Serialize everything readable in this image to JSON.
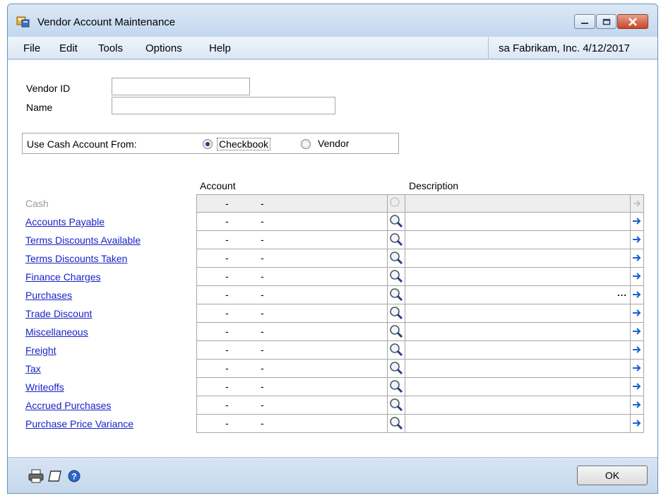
{
  "window": {
    "title": "Vendor Account Maintenance"
  },
  "menu": {
    "items": [
      "File",
      "Edit",
      "Tools",
      "Options",
      "Help"
    ],
    "status": "sa  Fabrikam, Inc. 4/12/2017"
  },
  "form": {
    "vendor_id_label": "Vendor ID",
    "vendor_id_value": "",
    "name_label": "Name",
    "name_value": "",
    "cash_from_label": "Use Cash Account From:",
    "option_checkbook": "Checkbook",
    "option_vendor": "Vendor",
    "selected_option": "Checkbook"
  },
  "grid": {
    "col_account": "Account",
    "col_description": "Description",
    "rows": [
      {
        "label": "Cash",
        "enabled": false
      },
      {
        "label": "Accounts Payable",
        "enabled": true
      },
      {
        "label": "Terms Discounts Available",
        "enabled": true
      },
      {
        "label": "Terms Discounts Taken",
        "enabled": true
      },
      {
        "label": "Finance Charges",
        "enabled": true
      },
      {
        "label": "Purchases",
        "enabled": true
      },
      {
        "label": "Trade Discount",
        "enabled": true
      },
      {
        "label": "Miscellaneous",
        "enabled": true
      },
      {
        "label": "Freight",
        "enabled": true
      },
      {
        "label": "Tax",
        "enabled": true
      },
      {
        "label": "Writeoffs",
        "enabled": true
      },
      {
        "label": "Accrued Purchases",
        "enabled": true
      },
      {
        "label": "Purchase Price Variance",
        "enabled": true
      }
    ],
    "ellipsis": "..."
  },
  "footer": {
    "ok_label": "OK"
  },
  "icons": [
    "printer-icon",
    "note-icon",
    "help-icon",
    "lookup-icon",
    "expand-arrow-icon"
  ],
  "colors": {
    "link": "#1a22c8",
    "accent": "#1f3f8a"
  }
}
